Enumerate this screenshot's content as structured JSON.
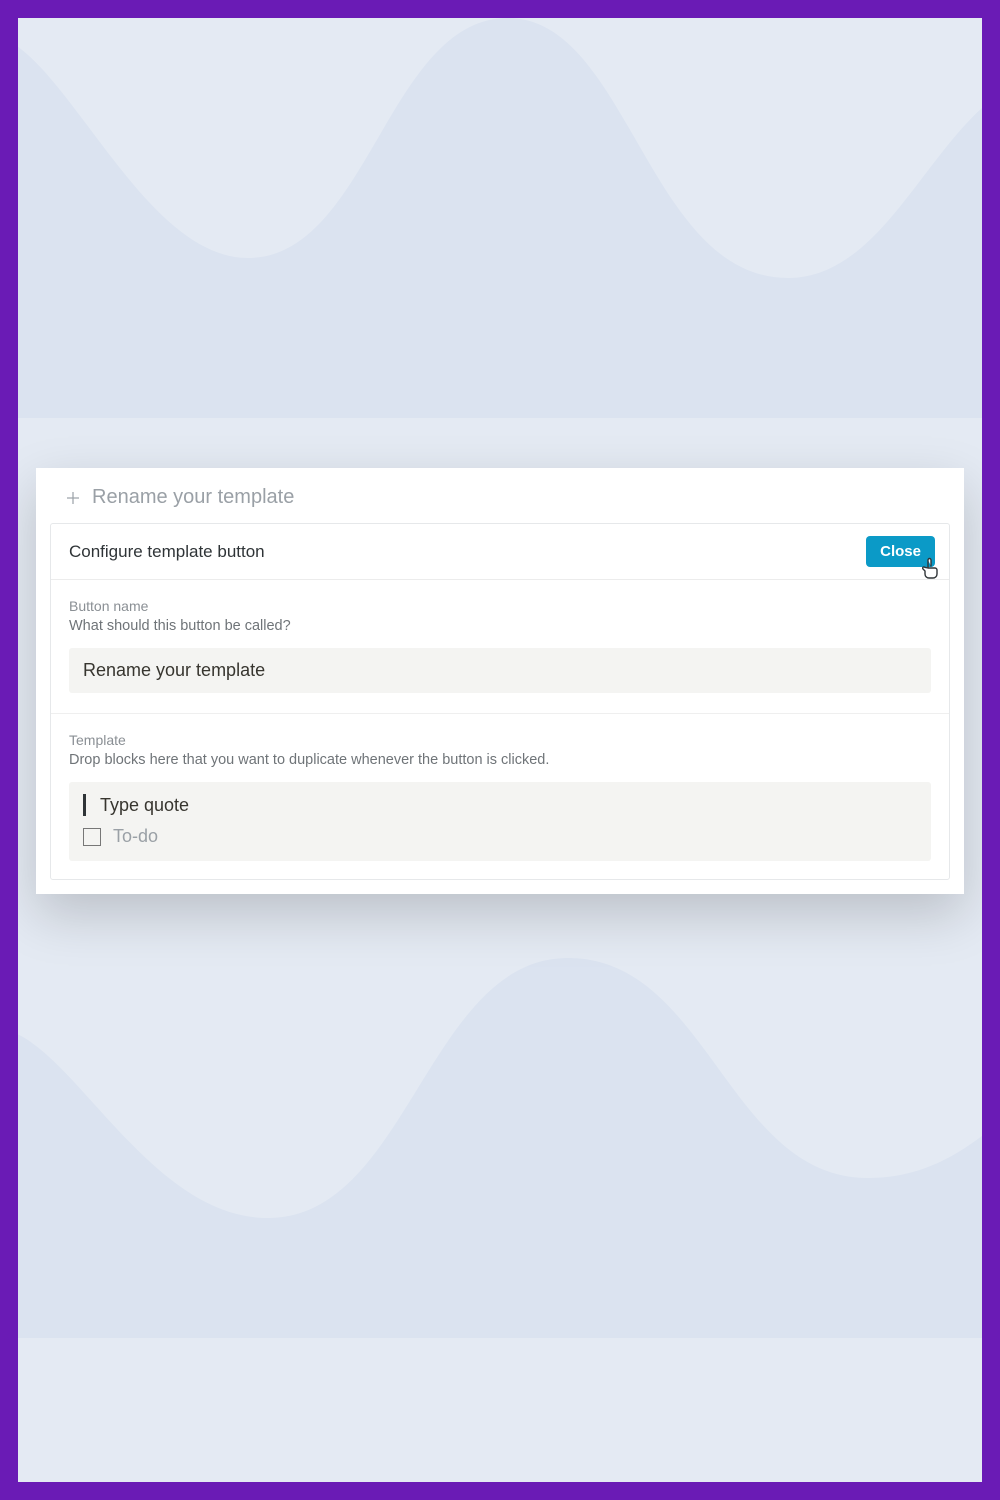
{
  "header": {
    "title": "Rename your template"
  },
  "panel": {
    "title": "Configure template button",
    "close_label": "Close"
  },
  "button_name": {
    "label": "Button name",
    "description": "What should this button be called?",
    "value": "Rename your template"
  },
  "template": {
    "label": "Template",
    "description": "Drop blocks here that you want to duplicate whenever the button is clicked.",
    "blocks": {
      "quote_text": "Type quote",
      "todo_text": "To-do"
    }
  }
}
